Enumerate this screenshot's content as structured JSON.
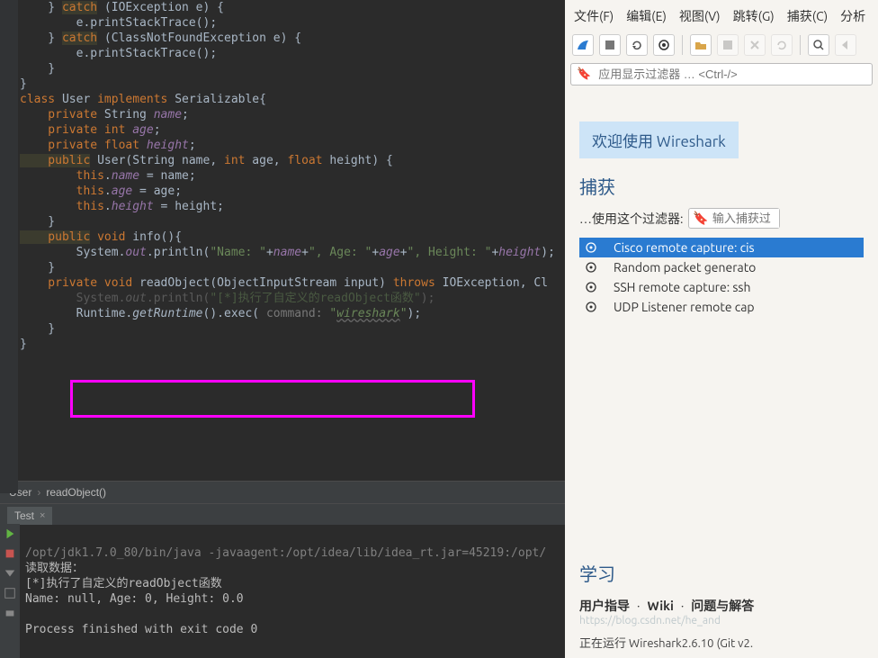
{
  "code": {
    "l0a": "    } ",
    "l0b": "catch",
    "l0c": " (IOException e) {",
    "l1": "        e.printStackTrace();",
    "l2a": "    } ",
    "l2b": "catch",
    "l2c": " (ClassNotFoundException e) {",
    "l3": "        e.printStackTrace();",
    "l4": "    }",
    "l5": "}",
    "l6": "",
    "l7a": "class",
    "l7b": " User ",
    "l7c": "implements",
    "l7d": " Serializable{",
    "l8a": "    private",
    "l8b": " String ",
    "l8c": "name",
    "l8d": ";",
    "l9a": "    private int ",
    "l9b": "age",
    "l9c": ";",
    "l10a": "    private float ",
    "l10b": "height",
    "l10c": ";",
    "l11": "",
    "l12a": "    public",
    "l12b": " User(String name, ",
    "l12c": "int",
    "l12d": " age, ",
    "l12e": "float",
    "l12f": " height) {",
    "l13a": "        this",
    "l13b": ".",
    "l13c": "name",
    "l13d": " = name;",
    "l14a": "        this",
    "l14b": ".",
    "l14c": "age",
    "l14d": " = age;",
    "l15a": "        this",
    "l15b": ".",
    "l15c": "height",
    "l15d": " = height;",
    "l16": "    }",
    "l17": "",
    "l18a": "    public",
    "l18b": " ",
    "l18c": "void",
    "l18d": " info(){",
    "l19a": "        System.",
    "l19b": "out",
    "l19c": ".println(",
    "l19d": "\"Name: \"",
    "l19e": "+",
    "l19f": "name",
    "l19g": "+",
    "l19h": "\", Age: \"",
    "l19i": "+",
    "l19j": "age",
    "l19k": "+",
    "l19l": "\", Height: \"",
    "l19m": "+",
    "l19n": "height",
    "l19o": ");",
    "l20": "    }",
    "l21": "",
    "l22a": "    private void",
    "l22b": " readObject(ObjectInputStream input) ",
    "l22c": "throws",
    "l22d": " IOException, Cl",
    "l23a": "        System.",
    "l23b": "out",
    "l23c": ".println(",
    "l23d": "\"[*]执行了自定义的readObject函数\"",
    "l23e": ");",
    "l24a": "        Runtime.",
    "l24b": "getRuntime",
    "l24c": "().exec( ",
    "l24hint": "command: ",
    "l24d": "\"",
    "l24e": "wireshark",
    "l24f": "\"",
    "l24g": ");",
    "l25": "    }",
    "l26": "}"
  },
  "breadcrumb": {
    "a": "User",
    "b": "readObject()"
  },
  "run": {
    "tab": "Test",
    "line1": "/opt/jdk1.7.0_80/bin/java -javaagent:/opt/idea/lib/idea_rt.jar=45219:/opt/",
    "line2": "读取数据：",
    "line3": "[*]执行了自定义的readObject函数",
    "line4": "Name: null, Age: 0, Height: 0.0",
    "line5": "",
    "line6": "Process finished with exit code 0"
  },
  "ws": {
    "menu": {
      "file": "文件(F)",
      "edit": "编辑(E)",
      "view": "视图(V)",
      "jump": "跳转(G)",
      "capture": "捕获(C)",
      "analyze": "分析"
    },
    "filter_placeholder": "应用显示过滤器 … <Ctrl-/>",
    "title": "欢迎使用 Wireshark",
    "capture_heading": "捕获",
    "filter_label": "…使用这个过滤器:",
    "cap_filter_placeholder": "输入捕获过",
    "interfaces": {
      "i0": "Cisco remote capture: cis",
      "i1": "Random packet generato",
      "i2": "SSH remote capture: ssh",
      "i3": "UDP Listener remote cap"
    },
    "learn_heading": "学习",
    "links": {
      "guide": "用户指导",
      "wiki": "Wiki",
      "qa": "问题与解答"
    },
    "ghost_url": "https://blog.csdn.net/he_and",
    "status": "正在运行 Wireshark2.6.10 (Git v2."
  }
}
